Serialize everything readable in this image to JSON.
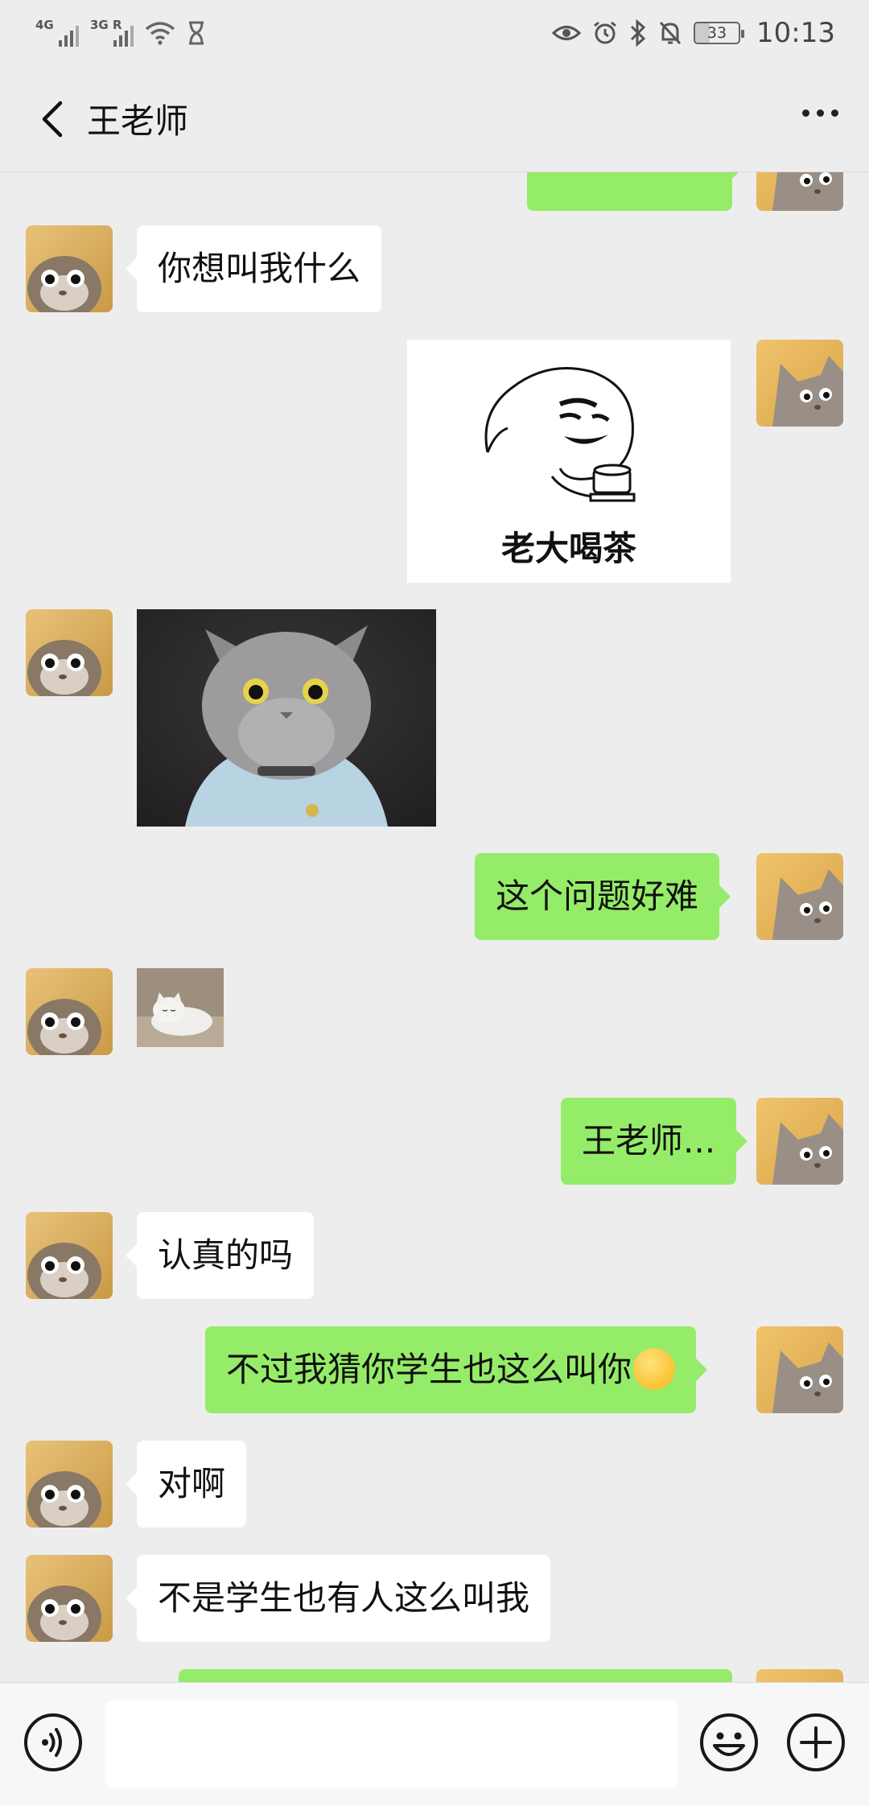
{
  "status_bar": {
    "sim1": "4G",
    "sim2": "3G R",
    "battery": "33",
    "time": "10:13"
  },
  "header": {
    "title": "王老师",
    "back_icon": "chevron-left-icon",
    "more_icon": "more-dots-icon"
  },
  "messages": [
    {
      "side": "out",
      "type": "text",
      "text": ""
    },
    {
      "side": "in",
      "type": "text",
      "text": "你想叫我什么"
    },
    {
      "side": "out",
      "type": "sticker",
      "caption": "老大喝茶"
    },
    {
      "side": "in",
      "type": "image",
      "desc": "cat-in-sweater"
    },
    {
      "side": "out",
      "type": "text",
      "text": "这个问题好难"
    },
    {
      "side": "in",
      "type": "image",
      "desc": "small-white-cat"
    },
    {
      "side": "out",
      "type": "text",
      "text": "王老师..."
    },
    {
      "side": "in",
      "type": "text",
      "text": "认真的吗"
    },
    {
      "side": "out",
      "type": "text",
      "text": "不过我猜你学生也这么叫你",
      "emoji": "laughing-crying-emoji"
    },
    {
      "side": "in",
      "type": "text",
      "text": "对啊"
    },
    {
      "side": "in",
      "type": "text",
      "text": "不是学生也有人这么叫我"
    },
    {
      "side": "out",
      "type": "text",
      "text": ""
    }
  ],
  "input_bar": {
    "voice_icon": "voice-icon",
    "input_value": "",
    "emoji_icon": "smiley-icon",
    "plus_icon": "plus-icon"
  },
  "colors": {
    "background": "#ededed",
    "outgoing_bubble": "#95ec69",
    "incoming_bubble": "#ffffff"
  }
}
